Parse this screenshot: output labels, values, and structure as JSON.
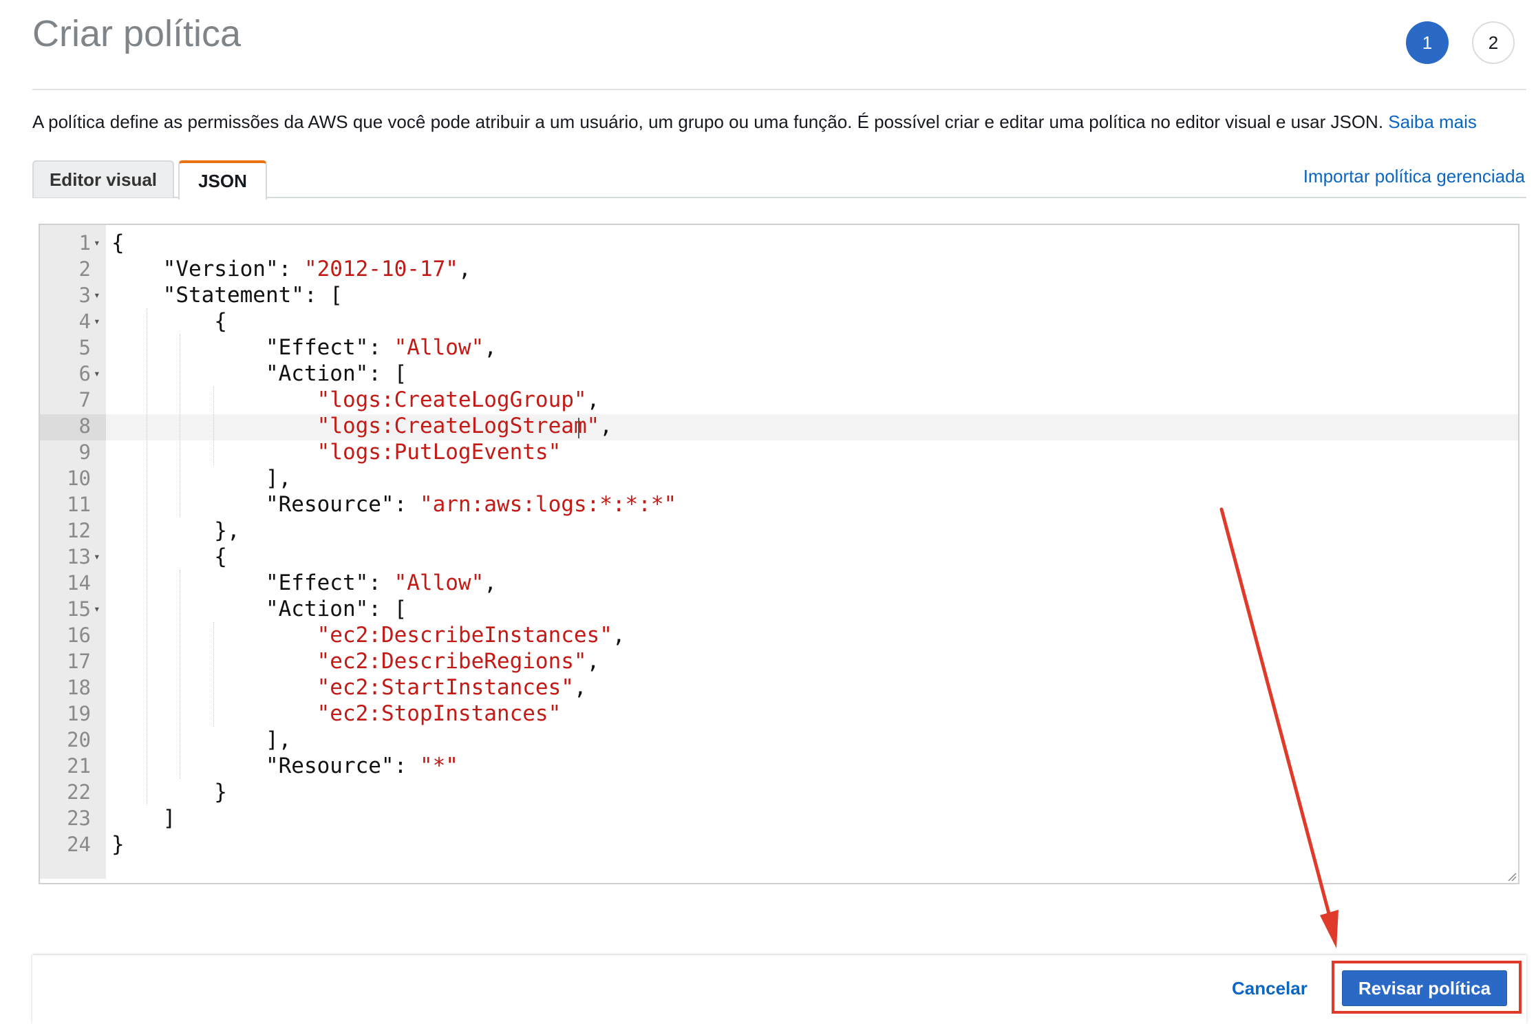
{
  "header": {
    "title": "Criar política",
    "steps": [
      "1",
      "2"
    ]
  },
  "description": {
    "text": "A política define as permissões da AWS que você pode atribuir a um usuário, um grupo ou uma função. É possível criar e editar uma política no editor visual e usar JSON. ",
    "link": "Saiba mais"
  },
  "tabs": {
    "visual_editor": "Editor visual",
    "json": "JSON",
    "active": "JSON"
  },
  "import_link": "Importar política gerenciada",
  "editor": {
    "active_line": 8,
    "lines": [
      {
        "n": "1",
        "parts": [
          [
            "p",
            "{"
          ]
        ]
      },
      {
        "n": "2",
        "parts": [
          [
            "p",
            "    \"Version\": "
          ],
          [
            "s",
            "\"2012-10-17\""
          ],
          [
            "p",
            ","
          ]
        ]
      },
      {
        "n": "3",
        "parts": [
          [
            "p",
            "    \"Statement\": ["
          ]
        ]
      },
      {
        "n": "4",
        "parts": [
          [
            "p",
            "        {"
          ]
        ]
      },
      {
        "n": "5",
        "parts": [
          [
            "p",
            "            \"Effect\": "
          ],
          [
            "s",
            "\"Allow\""
          ],
          [
            "p",
            ","
          ]
        ]
      },
      {
        "n": "6",
        "parts": [
          [
            "p",
            "            \"Action\": ["
          ]
        ]
      },
      {
        "n": "7",
        "parts": [
          [
            "p",
            "                "
          ],
          [
            "s",
            "\"logs:CreateLogGroup\""
          ],
          [
            "p",
            ","
          ]
        ]
      },
      {
        "n": "8",
        "parts": [
          [
            "p",
            "                "
          ],
          [
            "s",
            "\"logs:CreateLogStream\""
          ],
          [
            "p",
            ","
          ]
        ]
      },
      {
        "n": "9",
        "parts": [
          [
            "p",
            "                "
          ],
          [
            "s",
            "\"logs:PutLogEvents\""
          ]
        ]
      },
      {
        "n": "10",
        "parts": [
          [
            "p",
            "            ],"
          ]
        ]
      },
      {
        "n": "11",
        "parts": [
          [
            "p",
            "            \"Resource\": "
          ],
          [
            "s",
            "\"arn:aws:logs:*:*:*\""
          ]
        ]
      },
      {
        "n": "12",
        "parts": [
          [
            "p",
            "        },"
          ]
        ]
      },
      {
        "n": "13",
        "parts": [
          [
            "p",
            "        {"
          ]
        ]
      },
      {
        "n": "14",
        "parts": [
          [
            "p",
            "            \"Effect\": "
          ],
          [
            "s",
            "\"Allow\""
          ],
          [
            "p",
            ","
          ]
        ]
      },
      {
        "n": "15",
        "parts": [
          [
            "p",
            "            \"Action\": ["
          ]
        ]
      },
      {
        "n": "16",
        "parts": [
          [
            "p",
            "                "
          ],
          [
            "s",
            "\"ec2:DescribeInstances\""
          ],
          [
            "p",
            ","
          ]
        ]
      },
      {
        "n": "17",
        "parts": [
          [
            "p",
            "                "
          ],
          [
            "s",
            "\"ec2:DescribeRegions\""
          ],
          [
            "p",
            ","
          ]
        ]
      },
      {
        "n": "18",
        "parts": [
          [
            "p",
            "                "
          ],
          [
            "s",
            "\"ec2:StartInstances\""
          ],
          [
            "p",
            ","
          ]
        ]
      },
      {
        "n": "19",
        "parts": [
          [
            "p",
            "                "
          ],
          [
            "s",
            "\"ec2:StopInstances\""
          ]
        ]
      },
      {
        "n": "20",
        "parts": [
          [
            "p",
            "            ],"
          ]
        ]
      },
      {
        "n": "21",
        "parts": [
          [
            "p",
            "            \"Resource\": "
          ],
          [
            "s",
            "\"*\""
          ]
        ]
      },
      {
        "n": "22",
        "parts": [
          [
            "p",
            "        }"
          ]
        ]
      },
      {
        "n": "23",
        "parts": [
          [
            "p",
            "    ]"
          ]
        ]
      },
      {
        "n": "24",
        "parts": [
          [
            "p",
            "}"
          ]
        ]
      }
    ],
    "fold_lines": [
      "1",
      "3",
      "4",
      "6",
      "13",
      "15"
    ]
  },
  "footer": {
    "cancel": "Cancelar",
    "review": "Revisar política"
  },
  "colors": {
    "accent": "#2a6ac6",
    "link": "#0a66c2",
    "tab_active_border": "#ec7211",
    "json_string": "#c41a16",
    "annotation": "#e03a2a"
  },
  "icons": {
    "fold_marker": "caret-down-icon",
    "resize": "resize-grip-icon",
    "annotation": "red-arrow-annotation"
  }
}
